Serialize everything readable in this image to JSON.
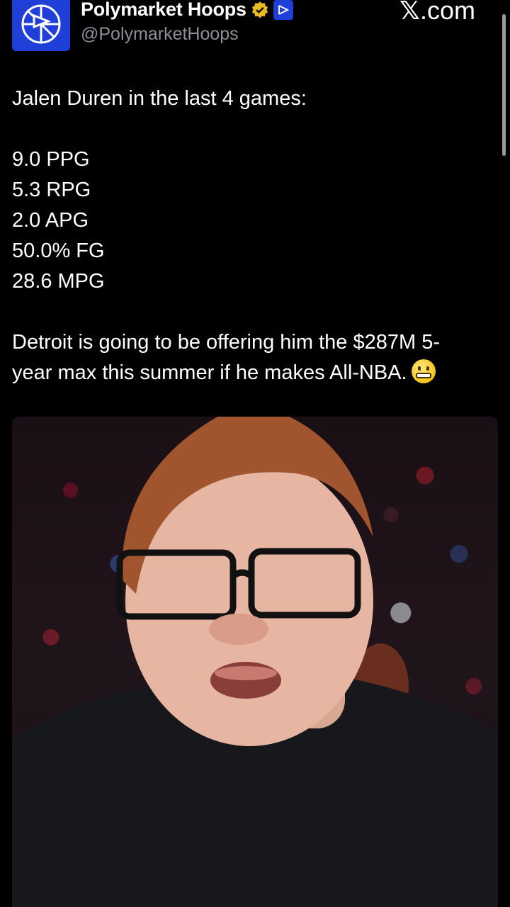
{
  "header": {
    "display_name": "Polymarket Hoops",
    "handle": "@PolymarketHoops",
    "site_mark_x": "𝕏",
    "site_mark_domain": ".com"
  },
  "tweet": {
    "intro": "Jalen Duren in the last 4 games:",
    "stats": [
      "9.0 PPG",
      "5.3 RPG",
      "2.0 APG",
      "50.0% FG",
      "28.6 MPG"
    ],
    "body_line1": "Detroit is going to be offering him the $287M 5-",
    "body_line2": "year max this summer if he makes All-NBA."
  },
  "icons": {
    "avatar": "polymarket-logo-icon",
    "verified": "verified-badge-icon",
    "affiliate": "affiliate-badge-icon",
    "emoji": "grimacing-face-icon"
  },
  "colors": {
    "brand_blue": "#1f3fd8",
    "verified_gold": "#e8b923",
    "handle_gray": "#8b9096"
  }
}
